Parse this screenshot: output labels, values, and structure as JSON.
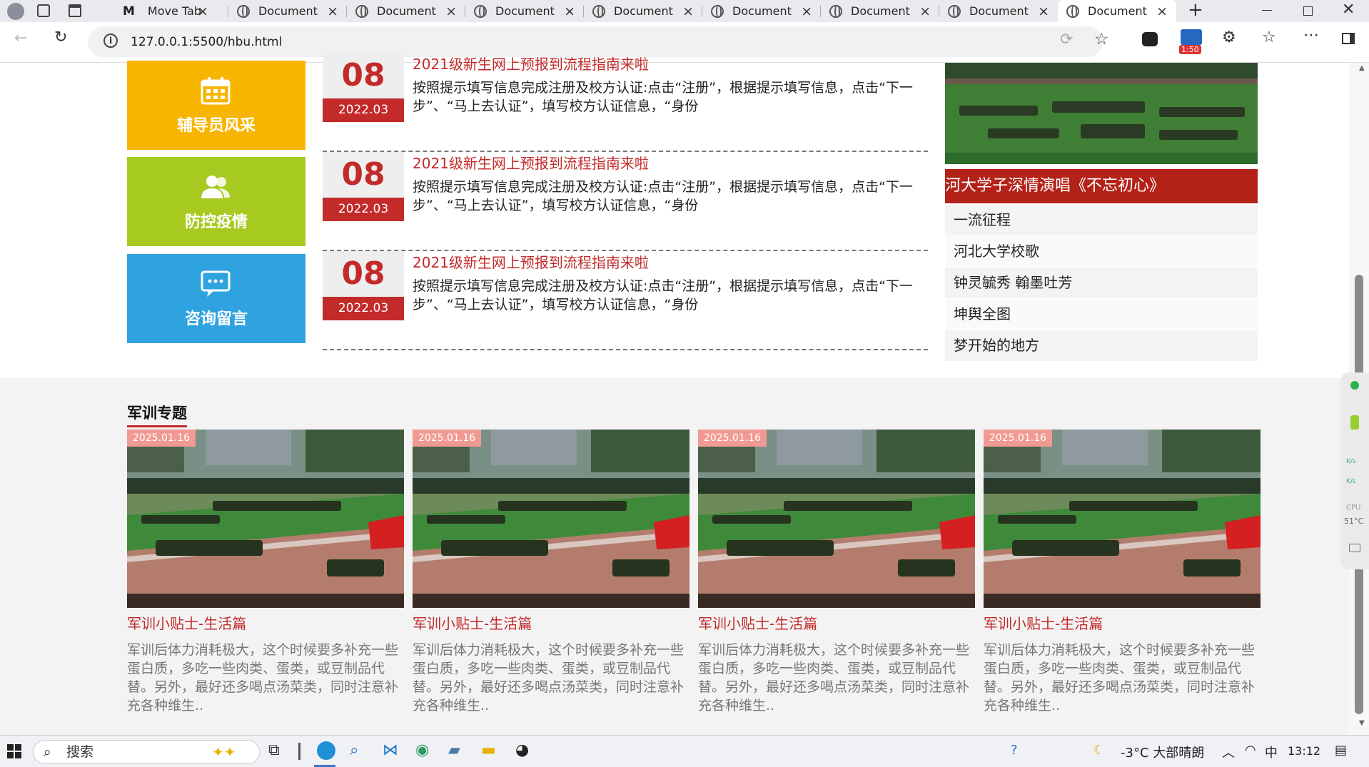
{
  "browser": {
    "tabs": [
      {
        "label": "Move Tab",
        "icon": "m-logo-icon"
      },
      {
        "label": "Document",
        "icon": "globe-icon"
      },
      {
        "label": "Document",
        "icon": "globe-icon"
      },
      {
        "label": "Document",
        "icon": "globe-icon"
      },
      {
        "label": "Document",
        "icon": "globe-icon"
      },
      {
        "label": "Document",
        "icon": "globe-icon"
      },
      {
        "label": "Document",
        "icon": "globe-icon"
      },
      {
        "label": "Document",
        "icon": "globe-icon"
      },
      {
        "label": "Document",
        "icon": "globe-icon",
        "active": true
      }
    ],
    "url": "127.0.0.1:5500/hbu.html",
    "extension_badge": "1:50"
  },
  "tiles": [
    {
      "label": "辅导员风采",
      "icon": "calendar-icon",
      "color": "#f7b500"
    },
    {
      "label": "防控疫情",
      "icon": "users-icon",
      "color": "#a6ca1f"
    },
    {
      "label": "咨询留言",
      "icon": "chat-icon",
      "color": "#2fa2e0"
    }
  ],
  "news": [
    {
      "day": "08",
      "ym": "2022.03",
      "title": "2021级新生网上预报到流程指南来啦",
      "desc": "按照提示填写信息完成注册及校方认证:点击“注册”，根据提示填写信息，点击“下一步”、“马上去认证”，填写校方认证信息，“身份"
    },
    {
      "day": "08",
      "ym": "2022.03",
      "title": "2021级新生网上预报到流程指南来啦",
      "desc": "按照提示填写信息完成注册及校方认证:点击“注册”，根据提示填写信息，点击“下一步”、“马上去认证”，填写校方认证信息，“身份"
    },
    {
      "day": "08",
      "ym": "2022.03",
      "title": "2021级新生网上预报到流程指南来啦",
      "desc": "按照提示填写信息完成注册及校方认证:点击“注册”，根据提示填写信息，点击“下一步”、“马上去认证”，填写校方认证信息，“身份"
    }
  ],
  "video": {
    "title": "河大学子深情演唱《不忘初心》",
    "list": [
      "一流征程",
      "河北大学校歌",
      "钟灵毓秀 翰墨吐芳",
      "坤舆全图",
      "梦开始的地方"
    ]
  },
  "military": {
    "section_title": "军训专题",
    "cards": [
      {
        "date": "2025.01.16",
        "title": "军训小贴士-生活篇",
        "desc": "军训后体力消耗极大，这个时候要多补充一些蛋白质，多吃一些肉类、蛋类，或豆制品代替。另外，最好还多喝点汤菜类，同时注意补充各种维生.."
      },
      {
        "date": "2025.01.16",
        "title": "军训小贴士-生活篇",
        "desc": "军训后体力消耗极大，这个时候要多补充一些蛋白质，多吃一些肉类、蛋类，或豆制品代替。另外，最好还多喝点汤菜类，同时注意补充各种维生.."
      },
      {
        "date": "2025.01.16",
        "title": "军训小贴士-生活篇",
        "desc": "军训后体力消耗极大，这个时候要多补充一些蛋白质，多吃一些肉类、蛋类，或豆制品代替。另外，最好还多喝点汤菜类，同时注意补充各种维生.."
      },
      {
        "date": "2025.01.16",
        "title": "军训小贴士-生活篇",
        "desc": "军训后体力消耗极大，这个时候要多补充一些蛋白质，多吃一些肉类、蛋类，或豆制品代替。另外，最好还多喝点汤菜类，同时注意补充各种维生.."
      }
    ]
  },
  "sidebar_widget": {
    "net_up": "K/s",
    "net_down": "K/s",
    "cpu_label": "CPU",
    "cpu_temp": "51°C"
  },
  "taskbar": {
    "search_placeholder": "搜索",
    "weather": "-3°C  大部晴朗",
    "ime": "中",
    "time": "13:12"
  }
}
